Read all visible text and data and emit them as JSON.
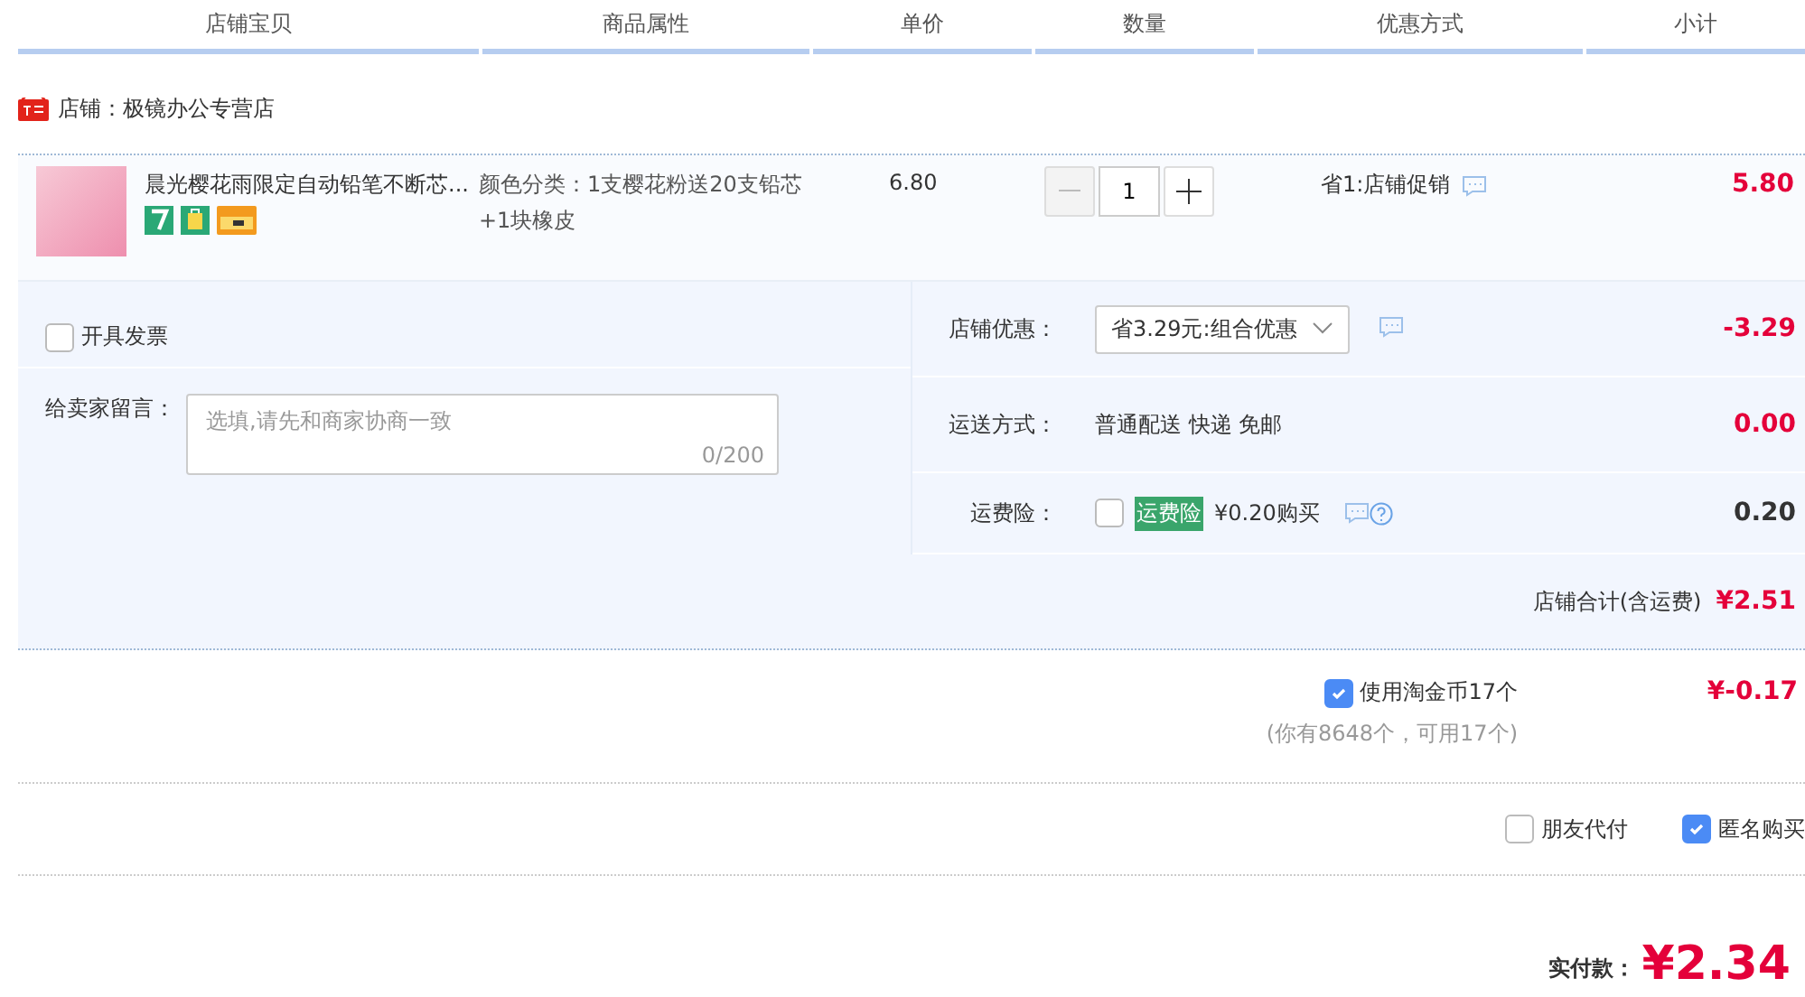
{
  "columns": [
    "店铺宝贝",
    "商品属性",
    "单价",
    "数量",
    "优惠方式",
    "小计"
  ],
  "shop": {
    "label": "店铺：极镜办公专营店"
  },
  "item": {
    "title": "晨光樱花雨限定自动铅笔不断芯...",
    "attributes": "颜色分类：1支樱花粉送20支铅芯+1块橡皮",
    "price": "6.80",
    "quantity": "1",
    "promo": "省1:店铺促销",
    "subtotal": "5.80"
  },
  "invoice": {
    "label": "开具发票",
    "checked": false
  },
  "message": {
    "label": "给卖家留言：",
    "placeholder": "选填,请先和商家协商一致",
    "counter": "0/200"
  },
  "fees": [
    {
      "kind": "select",
      "label": "店铺优惠：",
      "value": "省3.29元:组合优惠",
      "amount": "-3.29",
      "emphasis": true
    },
    {
      "kind": "text",
      "label": "运送方式：",
      "value": "普通配送 快递 免邮",
      "amount": "0.00",
      "emphasis": true
    },
    {
      "kind": "insurance",
      "label": "运费险：",
      "checked": false,
      "tag": "运费险",
      "value": "¥0.20购买",
      "amount": "0.20",
      "emphasis": false
    }
  ],
  "shop_total": {
    "label": "店铺合计(含运费)",
    "amount": "¥2.51"
  },
  "coins": {
    "label": "使用淘金币17个",
    "checked": true,
    "note": "(你有8648个，可用17个)",
    "amount": "¥-0.17"
  },
  "options": [
    {
      "label": "朋友代付",
      "checked": false
    },
    {
      "label": "匿名购买",
      "checked": true
    }
  ],
  "payment": {
    "label": "实付款：",
    "amount": "¥2.34"
  }
}
